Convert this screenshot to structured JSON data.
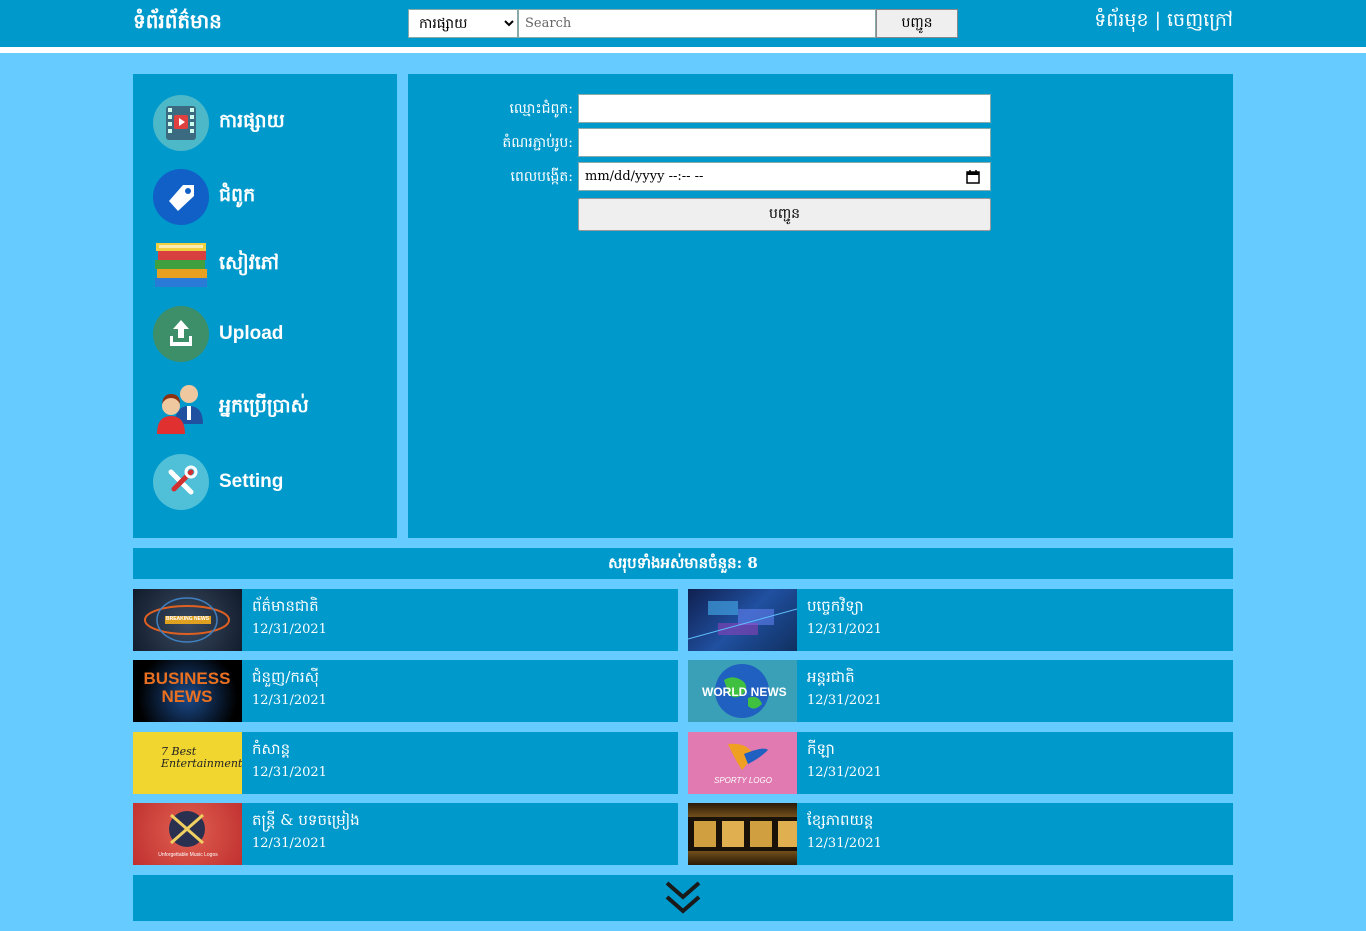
{
  "header": {
    "brand": "ទំព័រព័ត៌មាន",
    "category_selected": "ការផ្សាយ",
    "search_placeholder": "Search",
    "search_button": "បញ្ជូន",
    "link_home": "ទំព័រមុខ",
    "separator": "|",
    "link_logout": "ចេញក្រៅ"
  },
  "sidebar": {
    "items": [
      {
        "label": "ការផ្សាយ",
        "icon": "video-icon"
      },
      {
        "label": "ជំពូក",
        "icon": "tag-icon"
      },
      {
        "label": "សៀវភៅ",
        "icon": "books-icon"
      },
      {
        "label": "Upload",
        "icon": "upload-icon"
      },
      {
        "label": "អ្នកប្រើប្រាស់",
        "icon": "users-icon"
      },
      {
        "label": "Setting",
        "icon": "tools-icon"
      }
    ]
  },
  "form": {
    "name_label": "ឈ្មោះជំពូក:",
    "name_value": "",
    "image_label": "តំណរភ្ជាប់រូប:",
    "image_value": "",
    "date_label": "ពេលបង្កើត:",
    "date_placeholder": "mm/dd/yyyy --:-- --",
    "submit_label": "បញ្ជូន"
  },
  "total": {
    "label": "សរុបទាំងអស់មានចំនួន: 8"
  },
  "posts": [
    {
      "title": "ព័ត៌មានជាតិ",
      "date": "12/31/2021",
      "thumb_text": "BREAKING NEWS"
    },
    {
      "title": "បច្ចេកវិទ្យា",
      "date": "12/31/2021",
      "thumb_text": ""
    },
    {
      "title": "ជំនួញ/ករស៊ី",
      "date": "12/31/2021",
      "thumb_text": "BUSINESS NEWS"
    },
    {
      "title": "អន្តរជាតិ",
      "date": "12/31/2021",
      "thumb_text": "WORLD NEWS"
    },
    {
      "title": "កំសាន្ត",
      "date": "12/31/2021",
      "thumb_text": "7 Best Entertainment"
    },
    {
      "title": "កីឡា",
      "date": "12/31/2021",
      "thumb_text": "SPORTY LOGO"
    },
    {
      "title": "តន្ត្រី & បទចម្រៀង",
      "date": "12/31/2021",
      "thumb_text": "Unforgettable Music Logos"
    },
    {
      "title": "ខ្សែភាពយន្ត",
      "date": "12/31/2021",
      "thumb_text": ""
    }
  ],
  "more": {
    "icon": "double-chevron-down-icon"
  },
  "colors": {
    "background": "#66ccff",
    "panel": "#0099cc",
    "text": "#ffffff"
  }
}
